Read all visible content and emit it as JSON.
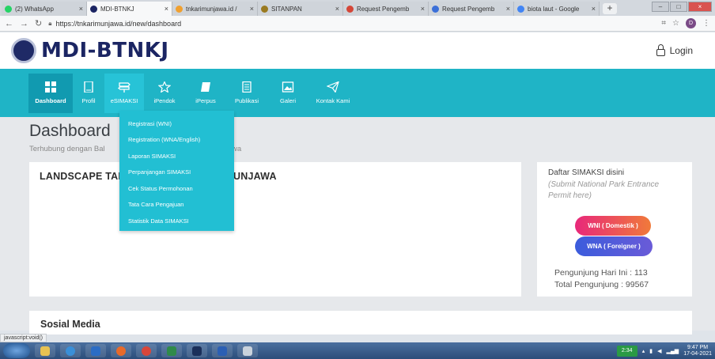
{
  "browser": {
    "tabs": [
      {
        "label": "(2) WhatsApp",
        "color": "#25d366"
      },
      {
        "label": "MDI-BTNKJ",
        "color": "#1b2563",
        "active": true
      },
      {
        "label": "tnkarimunjawa.id /",
        "color": "#f0a030"
      },
      {
        "label": "SITANPAN",
        "color": "#9a7a20"
      },
      {
        "label": "Request Pengemb",
        "color": "#d44638"
      },
      {
        "label": "Request Pengemb",
        "color": "#3b6fd8"
      },
      {
        "label": "biota laut - Google",
        "color": "#4285f4"
      }
    ],
    "new_tab": "+",
    "url": "https://tnkarimunjawa.id/new/dashboard",
    "profile_initial": "D"
  },
  "site": {
    "logo_text": "MDI-BTNKJ",
    "login_label": "Login"
  },
  "nav": [
    {
      "label": "Dashboard",
      "icon": "grid-icon"
    },
    {
      "label": "Profil",
      "icon": "document-icon"
    },
    {
      "label": "eSIMAKSI",
      "icon": "signpost-icon"
    },
    {
      "label": "iPendok",
      "icon": "star-icon"
    },
    {
      "label": "iPerpus",
      "icon": "book-icon"
    },
    {
      "label": "Publikasi",
      "icon": "newspaper-icon"
    },
    {
      "label": "Galeri",
      "icon": "image-icon"
    },
    {
      "label": "Kontak Kami",
      "icon": "paper-plane-icon"
    }
  ],
  "dropdown": [
    "Registrasi (WNI)",
    "Registration (WNA/English)",
    "Laporan SIMAKSI",
    "Perpanjangan SIMAKSI",
    "Cek Status Permohonan",
    "Tata Cara Pengajuan",
    "Statistik Data SIMAKSI"
  ],
  "page": {
    "title": "Dashboard",
    "subtitle_start": "Terhubung dengan Bal",
    "subtitle_end": "wa",
    "main_card_title_start": "LANDSCAPE TAN",
    "main_card_title_end": "UNJAWA",
    "side_head": "Daftar SIMAKSI disini",
    "side_sub": "(Submit National Park Entrance Permit here)",
    "btn_wni": "WNI ( Domestik )",
    "btn_wna": "WNA ( Foreigner )",
    "stat_today": "Pengunjung Hari Ini  :  113",
    "stat_total": "Total Pengunjung  :  99567",
    "social_title": "Sosial Media"
  },
  "status_link": "javascript:void()",
  "taskbar": {
    "clock_box": "2:34",
    "time": "9:47 PM",
    "date": "17-04-2021"
  },
  "colors": {
    "nav_bg": "#1fb4c6",
    "brand": "#1b2563"
  }
}
